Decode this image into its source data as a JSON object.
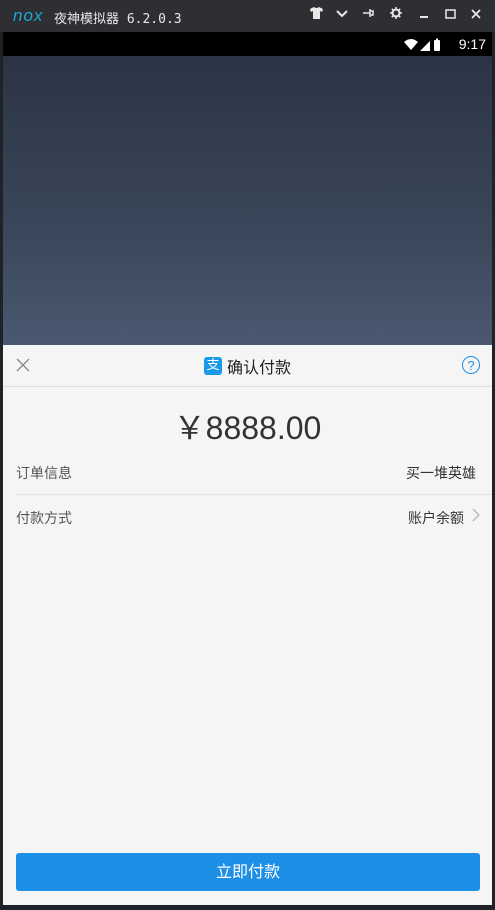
{
  "emulator": {
    "logo": "nox",
    "title": "夜神模拟器 6.2.0.3",
    "buttons": [
      "shirt-icon",
      "chevron-down-icon",
      "pin-icon",
      "gear-icon",
      "minimize-icon",
      "maximize-icon",
      "close-icon"
    ]
  },
  "status_bar": {
    "time": "9:17",
    "icons": [
      "wifi-icon",
      "signal-icon",
      "battery-icon"
    ]
  },
  "payment_sheet": {
    "title": "确认付款",
    "logo_glyph": "支",
    "help_glyph": "?",
    "amount": "￥8888.00",
    "rows": [
      {
        "label": "订单信息",
        "value": "买一堆英雄"
      },
      {
        "label": "付款方式",
        "value": "账户余额"
      }
    ],
    "confirm_button": "立即付款"
  },
  "colors": {
    "accent": "#1e8fe6",
    "sheet_bg": "#f5f5f5",
    "backdrop": "#3a475a"
  }
}
